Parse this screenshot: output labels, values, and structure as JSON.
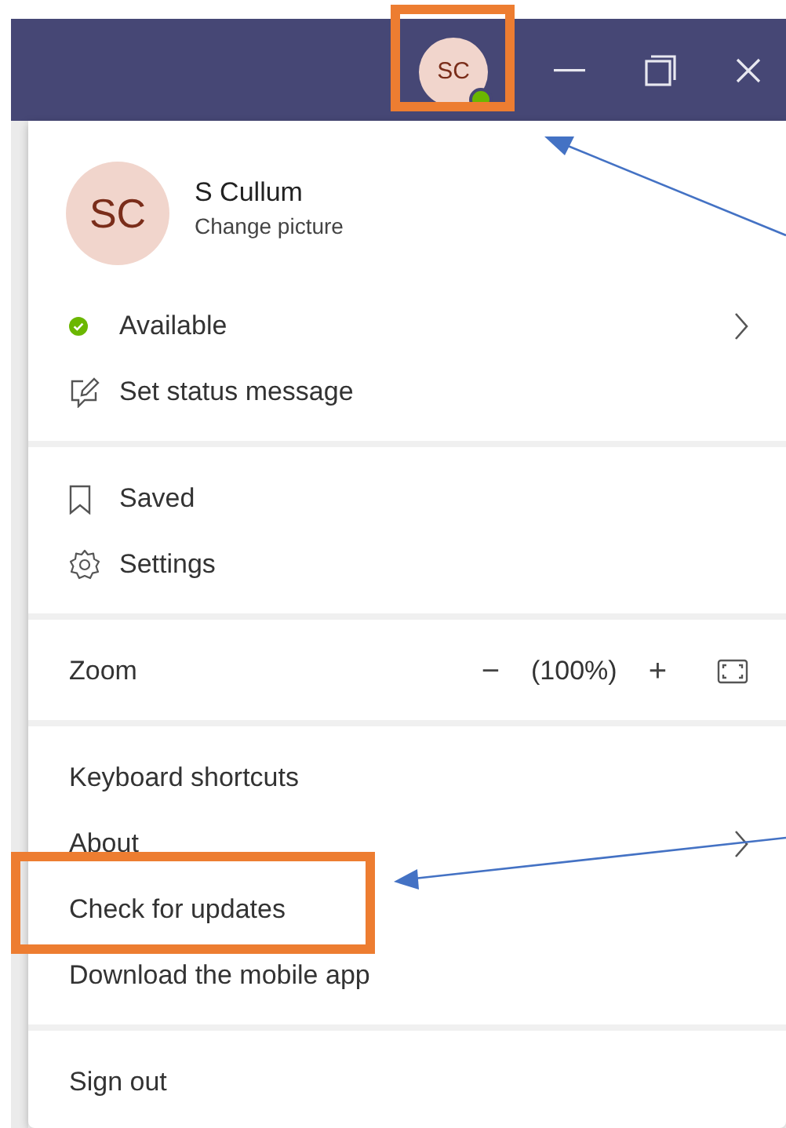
{
  "title_bar": {
    "avatar": {
      "initials": "SC",
      "color": "#6bb700"
    }
  },
  "profile": {
    "initials": "SC",
    "name": "S Cullum",
    "action": "Change picture"
  },
  "sections": [
    [
      {
        "kind": "status",
        "label": "Available",
        "color": "#6bb700",
        "submenu": true
      },
      {
        "kind": "message",
        "label": "Set status message",
        "submenu": false
      }
    ],
    [
      {
        "kind": "saved",
        "label": "Saved",
        "submenu": false
      },
      {
        "kind": "settings",
        "label": "Settings",
        "submenu": false
      }
    ],
    [
      {
        "kind": "zoom",
        "label": "Zoom",
        "minus": "−",
        "value": "(100%)",
        "plus": "+"
      }
    ],
    [
      {
        "kind": "plain",
        "label": "Keyboard shortcuts",
        "submenu": false
      },
      {
        "kind": "plain",
        "label": "About",
        "submenu": true
      },
      {
        "kind": "plain",
        "label": "Check for updates",
        "submenu": false
      },
      {
        "kind": "plain",
        "label": "Download the mobile app",
        "submenu": false
      }
    ],
    [
      {
        "kind": "plain",
        "label": "Sign out",
        "submenu": false
      }
    ]
  ]
}
